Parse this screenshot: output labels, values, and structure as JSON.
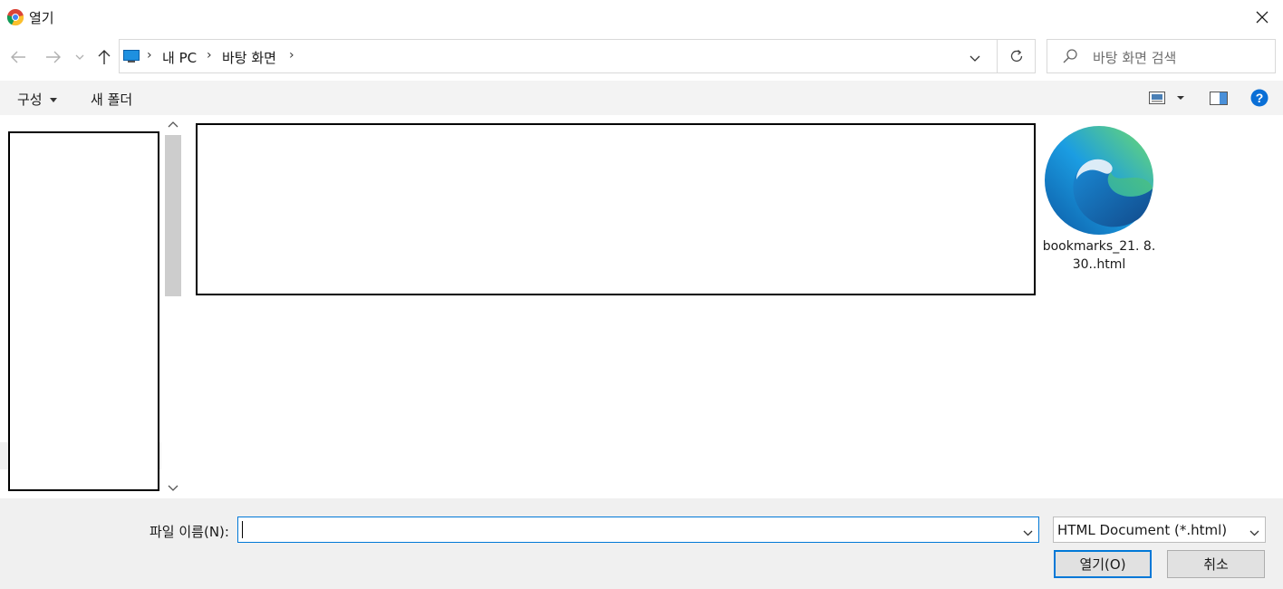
{
  "window": {
    "title": "열기",
    "app_icon": "chrome-icon",
    "close_icon": "close-icon"
  },
  "nav": {
    "back_icon": "arrow-left-icon",
    "forward_icon": "arrow-right-icon",
    "recent_icon": "chevron-down-icon",
    "up_icon": "arrow-up-icon",
    "address": {
      "segments": [
        "내 PC",
        "바탕 화면"
      ],
      "location_icon": "desktop-pc-icon"
    },
    "refresh_icon": "refresh-icon",
    "search": {
      "placeholder": "바탕 화면 검색",
      "icon": "search-icon"
    }
  },
  "toolbar": {
    "organize_label": "구성",
    "new_folder_label": "새 폴더",
    "view_icon": "view-options-icon",
    "preview_pane_icon": "preview-pane-icon",
    "help_icon": "help-icon"
  },
  "content": {
    "files": [
      {
        "name": "bookmarks_21. 8. 30..html",
        "icon": "edge-html-file-icon"
      }
    ]
  },
  "footer": {
    "filename_label": "파일 이름(N):",
    "filename_value": "",
    "file_type": "HTML Document (*.html)",
    "open_label": "열기(O)",
    "cancel_label": "취소"
  },
  "colors": {
    "accent": "#0078d7",
    "toolbar_bg": "#f3f3f3",
    "footer_bg": "#f0f0f0"
  }
}
